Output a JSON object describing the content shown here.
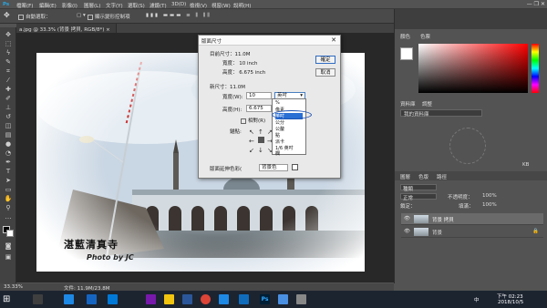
{
  "menubar": {
    "items": [
      "檔案(F)",
      "編輯(E)",
      "影像(I)",
      "圖層(L)",
      "文字(Y)",
      "選取(S)",
      "濾鏡(T)",
      "3D(D)",
      "檢視(V)",
      "視窗(W)",
      "說明(H)"
    ],
    "window_controls": "— ❐ ✕"
  },
  "options": {
    "auto_select_label": "自動選取：",
    "show_transform_label": "顯示變形控制項"
  },
  "document": {
    "tab_label": "a.jpg @ 33.3% (背景 拷貝, RGB/8*) ×",
    "watermark_cn": "湛藍清真寺",
    "watermark_en": "Photo by JC"
  },
  "status": {
    "zoom": "33.33%",
    "doc": "文件: 11.9M/23.8M"
  },
  "panels": {
    "color_tab": "顏色",
    "swatches_tab": "色票",
    "properties_tab": "資料庫",
    "adjust_tab": "調整",
    "library_select": "我的資料庫",
    "layers_tab": "圖層",
    "channels_tab": "色版",
    "paths_tab": "路徑",
    "kind_label": "種類",
    "blend_mode": "正常",
    "opacity_label": "不透明度：",
    "opacity_value": "100%",
    "lock_label": "鎖定：",
    "fill_label": "填滿：",
    "fill_value": "100%",
    "layers": [
      {
        "name": "背景 拷貝",
        "selected": true
      },
      {
        "name": "背景",
        "selected": false
      }
    ],
    "kb_label": "KB"
  },
  "dialog": {
    "title": "版面尺寸",
    "current_size_label": "目前尺寸：11.0M",
    "current_width": "寬度：  10 inch",
    "current_height": "高度：  6.675 inch",
    "new_size_label": "新尺寸：11.0M",
    "width_label": "寬度(W):",
    "width_value": "10",
    "unit_value": "英吋",
    "height_label": "高度(H):",
    "height_value": "6.675",
    "relative_label": "相對(R)",
    "anchor_label": "錨點:",
    "ext_color_label": "版面延伸色彩(",
    "ext_color_value": "背景色",
    "ok": "確定",
    "cancel": "取消",
    "dropdown_items": [
      "%",
      "像素",
      "英吋",
      "公分",
      "公釐",
      "點",
      "派卡",
      "1/6 英吋",
      "欄"
    ]
  },
  "taskbar": {
    "time": "下午 02:23",
    "date": "2018/10/5",
    "lang": "中"
  }
}
